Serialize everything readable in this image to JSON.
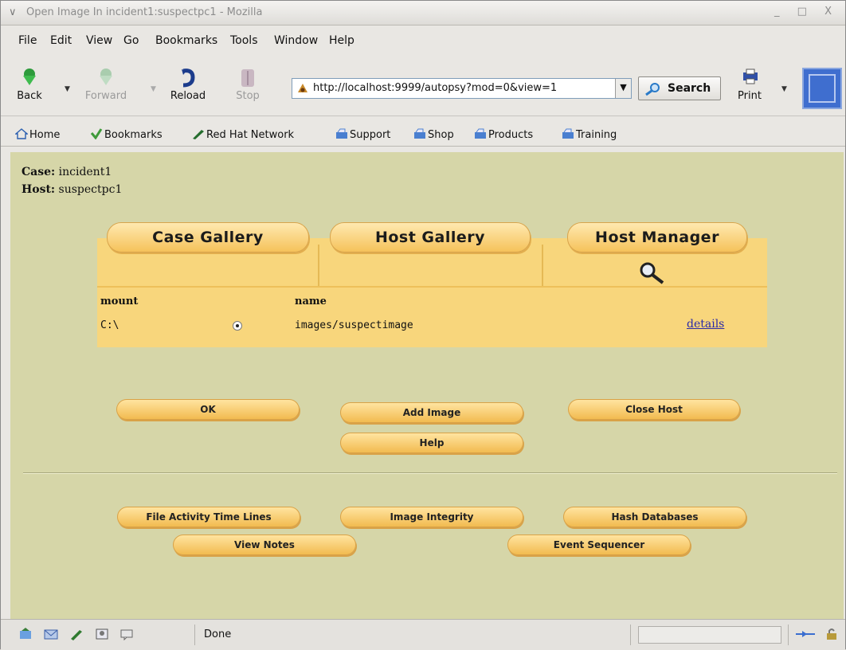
{
  "window": {
    "title": "Open Image In incident1:suspectpc1 - Mozilla",
    "controls": "_ □ X"
  },
  "menu": [
    "File",
    "Edit",
    "View",
    "Go",
    "Bookmarks",
    "Tools",
    "Window",
    "Help"
  ],
  "nav": {
    "back": "Back",
    "forward": "Forward",
    "reload": "Reload",
    "stop": "Stop",
    "url": "http://localhost:9999/autopsy?mod=0&view=1",
    "search": "Search",
    "print": "Print"
  },
  "bookmarks": [
    "Home",
    "Bookmarks",
    "Red Hat Network",
    "Support",
    "Shop",
    "Products",
    "Training"
  ],
  "page": {
    "case_label": "Case:",
    "case_value": "incident1",
    "host_label": "Host:",
    "host_value": "suspectpc1",
    "tabs": [
      "Case Gallery",
      "Host Gallery",
      "Host Manager"
    ],
    "table": {
      "col_mount": "mount",
      "col_name": "name",
      "mount": "C:\\",
      "name": "images/suspectimage",
      "details": "details"
    },
    "buttons": {
      "ok": "OK",
      "add_image": "Add Image",
      "close_host": "Close Host",
      "help": "Help",
      "file_activity": "File Activity Time Lines",
      "image_integrity": "Image Integrity",
      "hash_databases": "Hash Databases",
      "view_notes": "View Notes",
      "event_sequencer": "Event Sequencer"
    }
  },
  "status": {
    "text": "Done"
  },
  "colors": {
    "page_bg": "#d6d6a8",
    "panel": "#f8d67c",
    "button": "#f2bb50",
    "link": "#2a2aa8"
  }
}
